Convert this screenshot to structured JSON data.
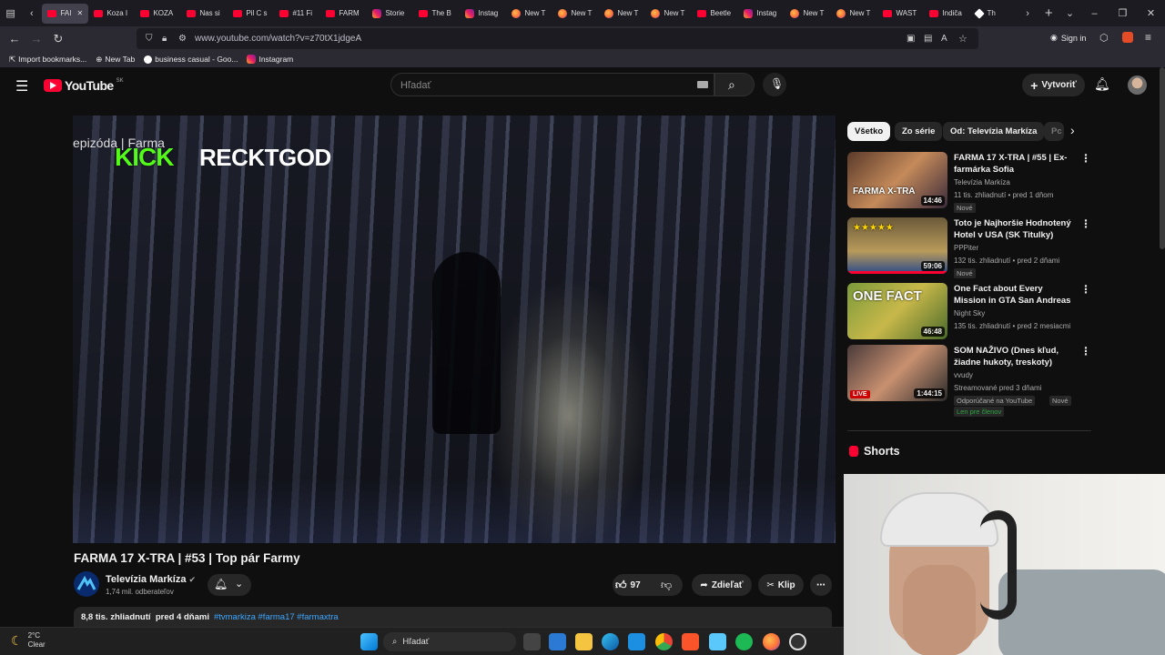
{
  "browser": {
    "tabs": [
      {
        "label": "FAI",
        "kind": "yt",
        "active": true
      },
      {
        "label": "Koza I",
        "kind": "yt"
      },
      {
        "label": "KOZA",
        "kind": "yt"
      },
      {
        "label": "Nas si",
        "kind": "yt"
      },
      {
        "label": "Pil C s",
        "kind": "yt"
      },
      {
        "label": "#11 Fi",
        "kind": "yt"
      },
      {
        "label": "FARM",
        "kind": "yt"
      },
      {
        "label": "Storie",
        "kind": "ig"
      },
      {
        "label": "The B",
        "kind": "yt"
      },
      {
        "label": "Instag",
        "kind": "ig"
      },
      {
        "label": "New T",
        "kind": "ff"
      },
      {
        "label": "New T",
        "kind": "ff"
      },
      {
        "label": "New T",
        "kind": "ff"
      },
      {
        "label": "New T",
        "kind": "ff"
      },
      {
        "label": "Beetle",
        "kind": "yt"
      },
      {
        "label": "Instag",
        "kind": "ig"
      },
      {
        "label": "New T",
        "kind": "ff"
      },
      {
        "label": "New T",
        "kind": "ff"
      },
      {
        "label": "WAST",
        "kind": "yt"
      },
      {
        "label": "Indiča",
        "kind": "yt"
      },
      {
        "label": "Th",
        "kind": "gh"
      }
    ],
    "url": "www.youtube.com/watch?v=z70tX1jdgeA",
    "sign_in": "Sign in",
    "bookmarks": [
      "Import bookmarks...",
      "New Tab",
      "business casual - Goo...",
      "Instagram"
    ]
  },
  "youtube": {
    "logo_text": "YouTube",
    "region": "SK",
    "search_placeholder": "Hľadať",
    "create_label": "Vytvoriť",
    "video": {
      "overlay_kick": "KICK",
      "overlay_name": "RECKTGOD",
      "overlay_episode": "epizóda  |  Farma",
      "title": "FARMA 17 X-TRA | #53 | Top pár Farmy",
      "channel": "Televízia Markíza",
      "subscribers": "1,74 mil. odberateľov",
      "likes": "97",
      "share_label": "Zdieľať",
      "clip_label": "Klip",
      "views": "8,8 tis. zhliadnutí",
      "age": "pred 4 dňami",
      "tags": "#tvmarkiza #farma17 #farmaxtra"
    },
    "chips": [
      "Všetko",
      "Zo série",
      "Od: Televízia Markíza",
      "Pc"
    ],
    "recommendations": [
      {
        "title": "FARMA 17 X-TRA | #55 | Ex-farmárka Sofia",
        "channel": "Televízia Markíza",
        "meta": "11 tis. zhliadnutí • pred 1 dňom",
        "badge": "Nové",
        "duration": "14:46",
        "thumb_text": "FARMA X-TRA"
      },
      {
        "title": "Toto je Najhoršie Hodnotený Hotel v USA (SK Titulky)",
        "channel": "PPPiter",
        "meta": "132 tis. zhliadnutí • pred 2 dňami",
        "badge": "Nové",
        "duration": "59:06",
        "thumb_text": "★★★★★"
      },
      {
        "title": "One Fact about Every Mission in GTA San Andreas",
        "channel": "Night Sky",
        "meta": "135 tis. zhliadnutí • pred 2 mesiacmi",
        "badge": "",
        "duration": "46:48",
        "thumb_text": "ONE FACT"
      },
      {
        "title": "SOM NAŽIVO (Dnes kľud, žiadne hukoty, treskoty)",
        "channel": "vvudy",
        "meta": "Streamované pred 3 dňami",
        "badge": "Odporúčané na YouTube",
        "badge2": "Nové",
        "extra": "Len pre členov",
        "duration": "1:44:15",
        "live": "LIVE"
      }
    ],
    "shorts_label": "Shorts"
  },
  "taskbar": {
    "temp": "2°C",
    "condition": "Clear",
    "search_label": "Hľadať"
  }
}
